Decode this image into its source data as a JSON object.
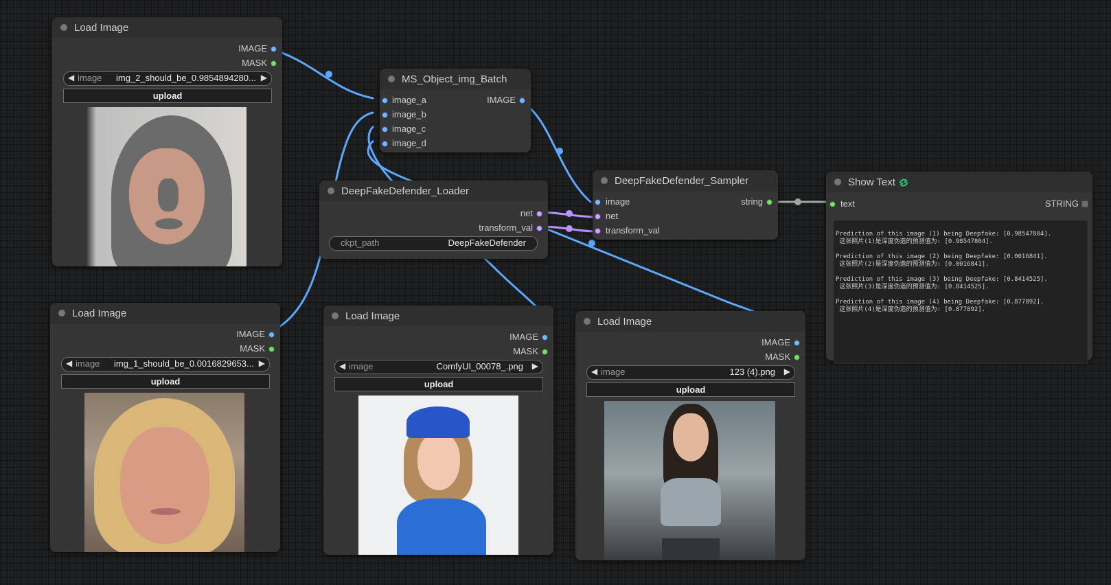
{
  "nodes": {
    "load1": {
      "title": "Load Image",
      "out_image": "IMAGE",
      "out_mask": "MASK",
      "image_key": "image",
      "image_value": "img_2_should_be_0.9854894280...",
      "upload": "upload"
    },
    "load2": {
      "title": "Load Image",
      "out_image": "IMAGE",
      "out_mask": "MASK",
      "image_key": "image",
      "image_value": "img_1_should_be_0.0016829653...",
      "upload": "upload"
    },
    "load3": {
      "title": "Load Image",
      "out_image": "IMAGE",
      "out_mask": "MASK",
      "image_key": "image",
      "image_value": "ComfyUI_00078_.png",
      "upload": "upload"
    },
    "load4": {
      "title": "Load Image",
      "out_image": "IMAGE",
      "out_mask": "MASK",
      "image_key": "image",
      "image_value": "123 (4).png",
      "upload": "upload"
    },
    "batch": {
      "title": "MS_Object_img_Batch",
      "in_a": "image_a",
      "in_b": "image_b",
      "in_c": "image_c",
      "in_d": "image_d",
      "out_image": "IMAGE"
    },
    "loader": {
      "title": "DeepFakeDefender_Loader",
      "out_net": "net",
      "out_transform": "transform_val",
      "ckpt_key": "ckpt_path",
      "ckpt_value": "DeepFakeDefender"
    },
    "sampler": {
      "title": "DeepFakeDefender_Sampler",
      "in_image": "image",
      "in_net": "net",
      "in_transform": "transform_val",
      "out_string": "string"
    },
    "show": {
      "title": "Show Text",
      "in_text": "text",
      "out_string": "STRING",
      "lines": [
        "Prediction of this image (1) being Deepfake: [0.98547804].",
        " 这张照片(1)是深度伪造的预测值为: [0.98547804].",
        "Prediction of this image (2) being Deepfake: [0.0016841].",
        " 这张照片(2)是深度伪造的预测值为: [0.0016841].",
        "Prediction of this image (3) being Deepfake: [0.8414525].",
        " 这张照片(3)是深度伪造的预测值为: [0.8414525].",
        "Prediction of this image (4) being Deepfake: [0.877892].",
        " 这张照片(4)是深度伪造的预测值为: [0.877892]."
      ]
    }
  },
  "colors": {
    "canvas": "#1e1f20",
    "node_body": "#353535",
    "node_header": "#2f2f2f",
    "link_image": "#5aa9ff",
    "link_net": "#b894ff",
    "link_string": "#9aa89a",
    "slot_image": "#78b7ff",
    "slot_mask": "#7bdc6a"
  }
}
